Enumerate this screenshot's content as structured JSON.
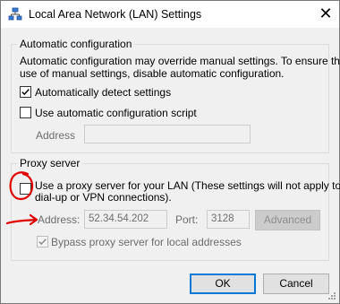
{
  "window": {
    "title": "Local Area Network (LAN) Settings",
    "close_glyph": "✕",
    "icon": "network-icon"
  },
  "auto_config": {
    "legend": "Automatic configuration",
    "description_line1": "Automatic configuration may override manual settings.  To ensure the",
    "description_line2": "use of manual settings, disable automatic configuration.",
    "auto_detect": {
      "label": "Automatically detect settings",
      "checked": true
    },
    "use_script": {
      "label": "Use automatic configuration script",
      "checked": false
    },
    "address_label": "Address",
    "address_value": ""
  },
  "proxy": {
    "legend": "Proxy server",
    "use_proxy": {
      "label_line1": "Use a proxy server for your LAN (These settings will not apply to",
      "label_line2": "dial-up or VPN connections).",
      "checked": false
    },
    "address_label": "Address:",
    "address_value": "52.34.54.202",
    "port_label": "Port:",
    "port_value": "3128",
    "advanced_label": "Advanced",
    "bypass": {
      "label": "Bypass proxy server for local addresses",
      "checked": true,
      "enabled": false
    }
  },
  "buttons": {
    "ok": "OK",
    "cancel": "Cancel"
  },
  "annotation_color": "#e00000"
}
